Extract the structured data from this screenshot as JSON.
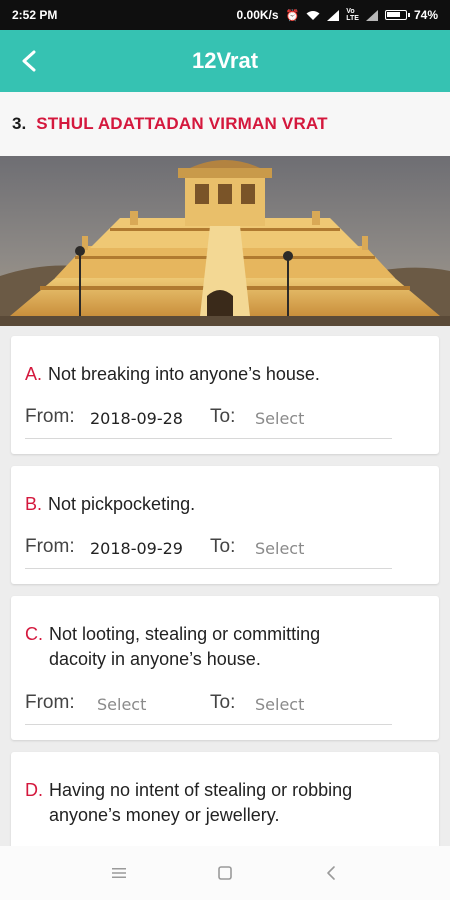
{
  "status_bar": {
    "time": "2:52 PM",
    "speed": "0.00K/s",
    "battery": "74%",
    "icons": [
      "alarm-icon",
      "wifi-icon",
      "signal-icon",
      "volte-icon",
      "signal-icon",
      "battery-icon"
    ]
  },
  "app_bar": {
    "title": "12Vrat",
    "back_icon": "chevron-left-icon"
  },
  "section": {
    "number": "3.",
    "title": "STHUL ADATTADAN VIRMAN VRAT"
  },
  "colors": {
    "accent": "#36c2b2",
    "title_red": "#d4183d"
  },
  "vows": [
    {
      "letter": "A.",
      "text": "Not breaking into anyone’s house.",
      "from_label": "From:",
      "from_value": "2018-09-28",
      "to_label": "To:",
      "to_value": "Select"
    },
    {
      "letter": "B.",
      "text": "Not pickpocketing.",
      "from_label": "From:",
      "from_value": "2018-09-29",
      "to_label": "To:",
      "to_value": "Select"
    },
    {
      "letter": "C.",
      "text_line1": "Not looting, stealing or committing",
      "text_line2": "dacoity in anyone’s house.",
      "from_label": "From:",
      "from_value": "Select",
      "to_label": "To:",
      "to_value": "Select"
    },
    {
      "letter": "D.",
      "text_line1": "Having no intent of stealing or robbing",
      "text_line2": "anyone’s money or jewellery."
    }
  ],
  "nav": {
    "icons": [
      "menu-icon",
      "home-square-icon",
      "back-triangle-icon"
    ]
  }
}
